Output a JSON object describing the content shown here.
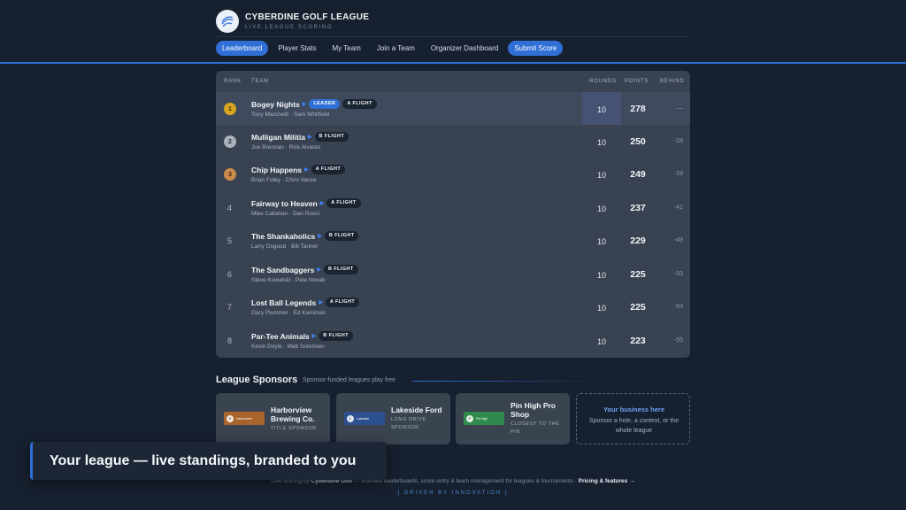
{
  "brand": {
    "title": "CYBERDINE GOLF LEAGUE",
    "subtitle": "LIVE LEAGUE SCORING",
    "logo_icon": "golf-swing-icon"
  },
  "nav": {
    "items": [
      "Leaderboard",
      "Player Stats",
      "My Team",
      "Join a Team",
      "Organizer Dashboard"
    ],
    "submit": "Submit Score",
    "active": "Leaderboard"
  },
  "table": {
    "headers": {
      "rank": "RANK",
      "team": "TEAM",
      "rounds": "ROUNDS",
      "points": "POINTS",
      "behind": "BEHIND"
    },
    "rows": [
      {
        "rank": "1",
        "team": "Bogey Nights",
        "leader_badge": "LEADER",
        "flight": "A FLIGHT",
        "players": "Tony Marchetti · Sam Whitfield",
        "rounds": "10",
        "points": "278",
        "behind": "—"
      },
      {
        "rank": "2",
        "team": "Mulligan Militia",
        "flight": "B FLIGHT",
        "players": "Joe Brennan · Rick Alvarez",
        "rounds": "10",
        "points": "250",
        "behind": "-28"
      },
      {
        "rank": "3",
        "team": "Chip Happens",
        "flight": "A FLIGHT",
        "players": "Brian Foley · Chris Vance",
        "rounds": "10",
        "points": "249",
        "behind": "-29"
      },
      {
        "rank": "4",
        "team": "Fairway to Heaven",
        "flight": "A FLIGHT",
        "players": "Mike Callahan · Dan Rossi",
        "rounds": "10",
        "points": "237",
        "behind": "-41"
      },
      {
        "rank": "5",
        "team": "The Shankaholics",
        "flight": "B FLIGHT",
        "players": "Larry Osgood · Bill Tanner",
        "rounds": "10",
        "points": "229",
        "behind": "-49"
      },
      {
        "rank": "6",
        "team": "The Sandbaggers",
        "flight": "B FLIGHT",
        "players": "Steve Kowalski · Pete Novak",
        "rounds": "10",
        "points": "225",
        "behind": "-53"
      },
      {
        "rank": "7",
        "team": "Lost Ball Legends",
        "flight": "A FLIGHT",
        "players": "Gary Plummer · Ed Kaminski",
        "rounds": "10",
        "points": "225",
        "behind": "-53"
      },
      {
        "rank": "8",
        "team": "Par-Tee Animals",
        "flight": "B FLIGHT",
        "players": "Kevin Doyle · Matt Sorensen",
        "rounds": "10",
        "points": "223",
        "behind": "-55"
      }
    ]
  },
  "sponsors": {
    "title": "League Sponsors",
    "subtitle": "Sponsor-funded leagues play free",
    "items": [
      {
        "name": "Harborview Brewing Co.",
        "role": "TITLE SPONSOR",
        "logo_text": "Harborview",
        "logo_color": "#a8642a"
      },
      {
        "name": "Lakeside Ford",
        "role": "LONG DRIVE SPONSOR",
        "logo_text": "Lakeside",
        "logo_color": "#2c4f8f"
      },
      {
        "name": "Pin High Pro Shop",
        "role": "CLOSEST TO THE PIN",
        "logo_text": "Pin High",
        "logo_color": "#2f8a4e"
      }
    ],
    "cta": {
      "title": "Your business here",
      "text": "Sponsor a hole, a contest, or the whole league"
    }
  },
  "footer": {
    "prefix": "Live scoring by",
    "brand": "Cyberdine Golf",
    "middle": "— branded leaderboards, score entry & team management for leagues & tournaments ·",
    "link": "Pricing & features →",
    "tagline": "[ DRIVEN BY INNOVATION ]"
  },
  "toast": {
    "text": "Your league — live standings, branded to you"
  },
  "colors": {
    "accent": "#2f6fd6",
    "gold": "#d9a520",
    "silver": "#a9b1bb",
    "bronze": "#c98a4a"
  }
}
